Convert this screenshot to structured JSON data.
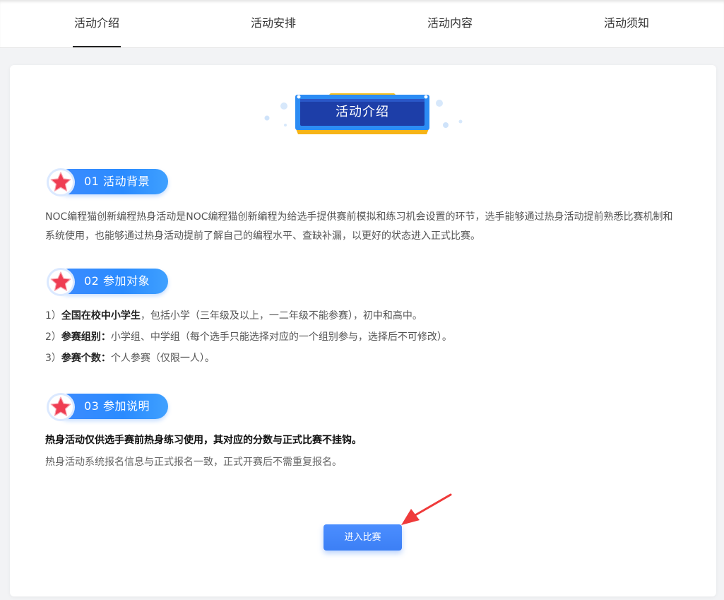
{
  "tabs": [
    {
      "label": "活动介绍",
      "active": true
    },
    {
      "label": "活动安排",
      "active": false
    },
    {
      "label": "活动内容",
      "active": false
    },
    {
      "label": "活动须知",
      "active": false
    }
  ],
  "banner": {
    "title": "活动介绍"
  },
  "sections": [
    {
      "number": "01",
      "title": "活动背景",
      "label": "01  活动背景"
    },
    {
      "number": "02",
      "title": "参加对象",
      "label": "02  参加对象"
    },
    {
      "number": "03",
      "title": "参加说明",
      "label": "03  参加说明"
    }
  ],
  "background_text": "NOC编程猫创新编程热身活动是NOC编程猫创新编程为给选手提供赛前模拟和练习机会设置的环节，选手能够通过热身活动提前熟悉比赛机制和系统使用，也能够通过热身活动提前了解自己的编程水平、查缺补漏，以更好的状态进入正式比赛。",
  "participants": [
    {
      "prefix": "1）",
      "bold": "全国在校中小学生",
      "rest": "，包括小学（三年级及以上，一二年级不能参赛），初中和高中。"
    },
    {
      "prefix": "2）",
      "bold": "参赛组别：",
      "rest": "小学组、中学组（每个选手只能选择对应的一个组别参与，选择后不可修改）。"
    },
    {
      "prefix": "3）",
      "bold": "参赛个数：",
      "rest": "个人参赛（仅限一人）。"
    }
  ],
  "instructions": {
    "bold_line": "热身活动仅供选手赛前热身练习使用，其对应的分数与正式比赛不挂钩。",
    "plain_line": "热身活动系统报名信息与正式报名一致，正式开赛后不需重复报名。"
  },
  "enter_button": {
    "label": "进入比赛"
  },
  "colors": {
    "accent": "#3b82f6",
    "banner_blue": "#1e3aa8",
    "banner_gold": "#f6c01e",
    "star_red": "#ef3d52"
  },
  "icons": {
    "star": "star-badge-icon",
    "arrow": "red-arrow-icon"
  }
}
